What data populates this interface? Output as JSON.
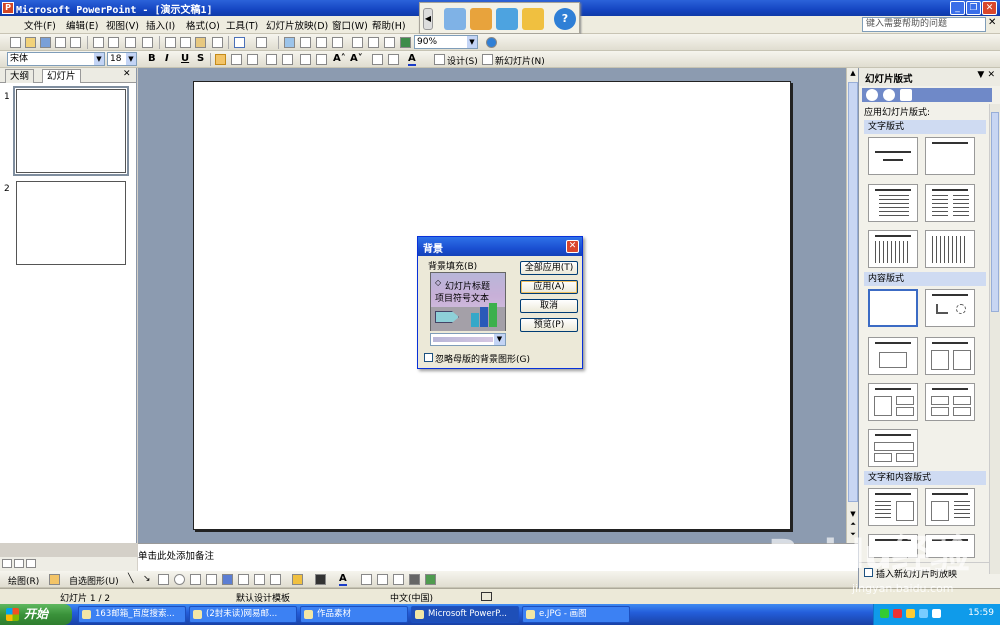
{
  "window": {
    "title": "Microsoft PowerPoint - [演示文稿1]"
  },
  "menu": {
    "items": [
      "文件(F)",
      "编辑(E)",
      "视图(V)",
      "插入(I)",
      "格式(O)",
      "工具(T)",
      "幻灯片放映(D)",
      "窗口(W)",
      "帮助(H)"
    ],
    "help_placeholder": "键入需要帮助的问题"
  },
  "toolbar": {
    "zoom": "90%"
  },
  "format_toolbar": {
    "font": "宋体",
    "size": "18",
    "design_label": "设计(S)",
    "new_slide_label": "新幻灯片(N)"
  },
  "left_pane": {
    "tabs": [
      "大纲",
      "幻灯片"
    ],
    "slide_numbers": [
      "1",
      "2"
    ]
  },
  "notes": {
    "placeholder": "单击此处添加备注"
  },
  "drawing_toolbar": {
    "draw_label": "绘图(R)",
    "autoshapes_label": "自选图形(U)"
  },
  "status": {
    "slide": "幻灯片 1 / 2",
    "template": "默认设计模板",
    "language": "中文(中国)"
  },
  "task_pane": {
    "title": "幻灯片版式",
    "apply_label": "应用幻灯片版式:",
    "sections": [
      "文字版式",
      "内容版式",
      "文字和内容版式"
    ],
    "bottom_label": "插入新幻灯片时放映"
  },
  "dialog": {
    "title": "背景",
    "group_label": "背景填充(B)",
    "preview_title": "幻灯片标题",
    "preview_bullet": "项目符号文本",
    "apply_all": "全部应用(T)",
    "apply": "应用(A)",
    "cancel": "取消",
    "preview": "预览(P)",
    "ignore_master": "忽略母版的背景图形(G)"
  },
  "taskbar": {
    "start": "开始",
    "tasks": [
      "163邮箱_百度搜索...",
      "(2封未读)网易邮...",
      "作品素材",
      "Microsoft PowerP...",
      "e.JPG - 画图"
    ],
    "clock": "15:59"
  },
  "watermark": {
    "logo": "Baidu经验",
    "url": "jingyan.baidu.com"
  },
  "colors": {
    "title_blue": "#1546c2",
    "work_area": "#8c9bb0",
    "start_green": "#3a923a"
  }
}
